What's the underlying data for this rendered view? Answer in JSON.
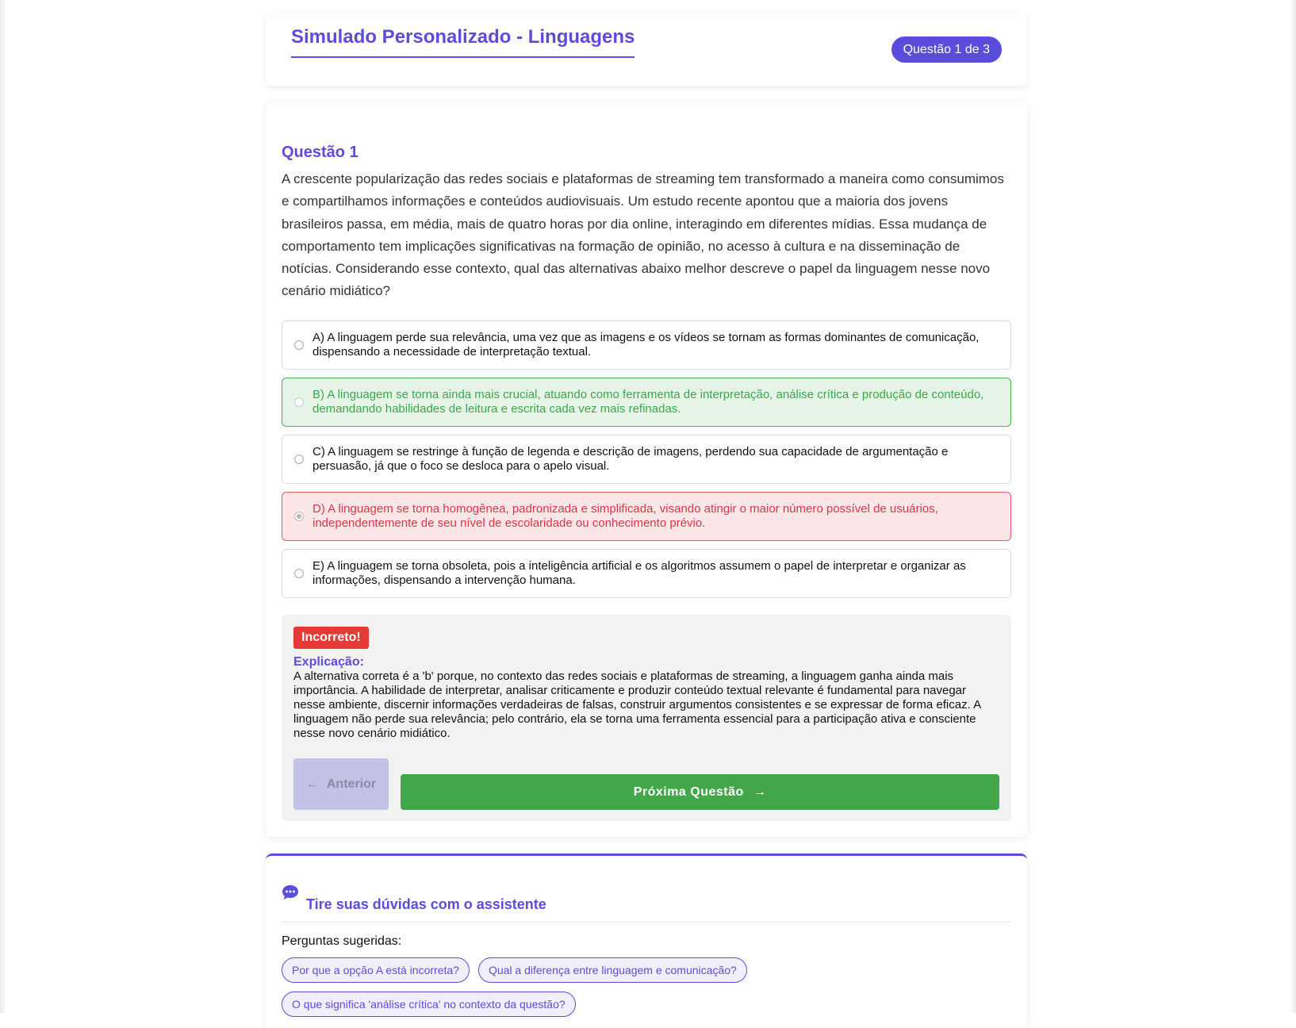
{
  "header": {
    "title": "Simulado Personalizado - Linguagens",
    "counter": "Questão 1 de 3"
  },
  "question": {
    "title": "Questão 1",
    "text": "A crescente popularização das redes sociais e plataformas de streaming tem transformado a maneira como consumimos e compartilhamos informações e conteúdos audiovisuais. Um estudo recente apontou que a maioria dos jovens brasileiros passa, em média, mais de quatro horas por dia online, interagindo em diferentes mídias. Essa mudança de comportamento tem implicações significativas na formação de opinião, no acesso à cultura e na disseminação de notícias. Considerando esse contexto, qual das alternativas abaixo melhor descreve o papel da linguagem nesse novo cenário midiático?",
    "options": [
      {
        "label": "A) A linguagem perde sua relevância, uma vez que as imagens e os vídeos se tornam as formas dominantes de comunicação, dispensando a necessidade de interpretação textual.",
        "state": "neutral",
        "selected": false
      },
      {
        "label": "B) A linguagem se torna ainda mais crucial, atuando como ferramenta de interpretação, análise crítica e produção de conteúdo, demandando habilidades de leitura e escrita cada vez mais refinadas.",
        "state": "correct",
        "selected": false
      },
      {
        "label": "C) A linguagem se restringe à função de legenda e descrição de imagens, perdendo sua capacidade de argumentação e persuasão, já que o foco se desloca para o apelo visual.",
        "state": "neutral",
        "selected": false
      },
      {
        "label": "D) A linguagem se torna homogênea, padronizada e simplificada, visando atingir o maior número possível de usuários, independentemente de seu nível de escolaridade ou conhecimento prévio.",
        "state": "wrong",
        "selected": true
      },
      {
        "label": "E) A linguagem se torna obsoleta, pois a inteligência artificial e os algoritmos assumem o papel de interpretar e organizar as informações, dispensando a intervenção humana.",
        "state": "neutral",
        "selected": false
      }
    ]
  },
  "feedback": {
    "result": "Incorreto!",
    "explanation_label": "Explicação:",
    "explanation_text": "A alternativa correta é a 'b' porque, no contexto das redes sociais e plataformas de streaming, a linguagem ganha ainda mais importância. A habilidade de interpretar, analisar criticamente e produzir conteúdo textual relevante é fundamental para navegar nesse ambiente, discernir informações verdadeiras de falsas, construir argumentos consistentes e se expressar de forma eficaz. A linguagem não perde sua relevância; pelo contrário, ela se torna uma ferramenta essencial para a participação ativa e consciente nesse novo cenário midiático."
  },
  "nav": {
    "prev_label": "Anterior",
    "prev_icon": "arrow-left-icon",
    "next_label": "Próxima Questão",
    "next_icon": "arrow-right-icon"
  },
  "assistant": {
    "icon": "chat-bubble-icon",
    "title": "Tire suas dúvidas com o assistente",
    "suggested_label": "Perguntas sugeridas:",
    "suggestions": [
      "Por que a opção A está incorreta?",
      "Qual a diferença entre linguagem e comunicação?",
      "O que significa 'análise crítica' no contexto da questão?"
    ]
  },
  "colors": {
    "accent": "#5b4ddb",
    "correct": "#43a648",
    "incorrect": "#e53935"
  }
}
